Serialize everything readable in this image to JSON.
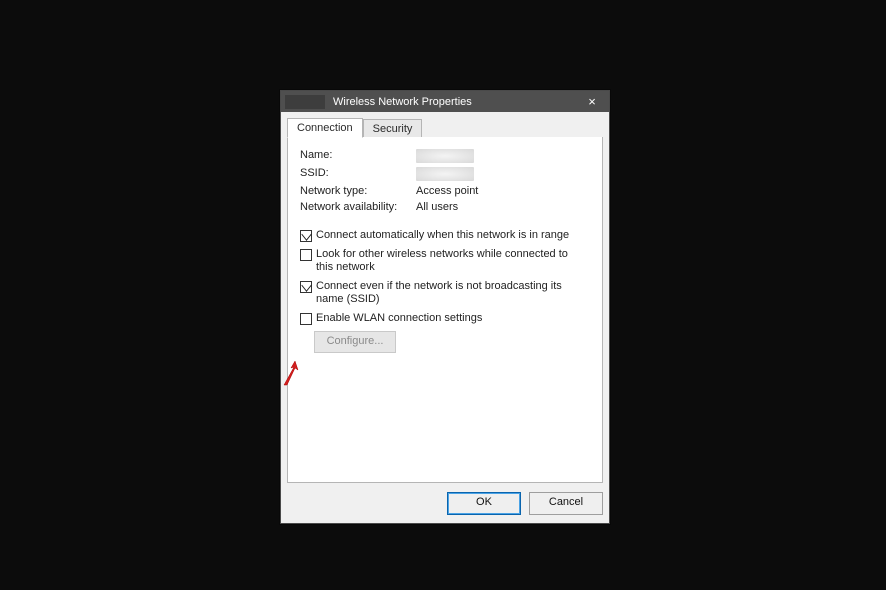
{
  "window": {
    "title": "Wireless Network Properties",
    "close_label": "×"
  },
  "tabs": {
    "connection": "Connection",
    "security": "Security"
  },
  "props": {
    "name_label": "Name:",
    "name_value": "",
    "ssid_label": "SSID:",
    "ssid_value": "",
    "nettype_label": "Network type:",
    "nettype_value": "Access point",
    "netavail_label": "Network availability:",
    "netavail_value": "All users"
  },
  "checks": {
    "auto_connect": {
      "label": "Connect automatically when this network is in range",
      "checked": true
    },
    "look_other": {
      "label": "Look for other wireless networks while connected to this network",
      "checked": false
    },
    "connect_hidden": {
      "label": "Connect even if the network is not broadcasting its name (SSID)",
      "checked": true
    },
    "enable_wlan": {
      "label": "Enable WLAN connection settings",
      "checked": false
    }
  },
  "configure_label": "Configure...",
  "buttons": {
    "ok": "OK",
    "cancel": "Cancel"
  }
}
